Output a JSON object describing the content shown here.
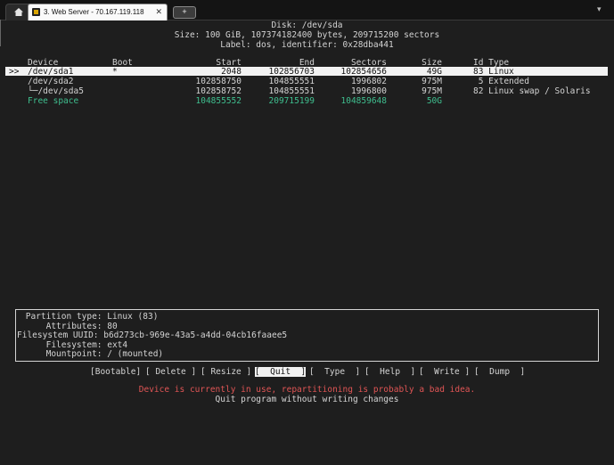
{
  "tabbar": {
    "home_icon": "home-icon",
    "tab_label": "3. Web Server - 70.167.119.118",
    "tab_close": "✕",
    "newtab_label": "+",
    "more_label": "▾"
  },
  "disk": {
    "line1": "Disk: /dev/sda",
    "line2": "Size: 100 GiB, 107374182400 bytes, 209715200 sectors",
    "line3": "Label: dos, identifier: 0x28dba441"
  },
  "table": {
    "headers": {
      "device": "Device",
      "boot": "Boot",
      "start": "Start",
      "end": "End",
      "sectors": "Sectors",
      "size": "Size",
      "id_type": "Id Type"
    },
    "rows": [
      {
        "marker": ">>",
        "device": "/dev/sda1",
        "boot": "*",
        "start": "2048",
        "end": "102856703",
        "sectors": "102854656",
        "size": "49G",
        "id_type": "83 Linux"
      },
      {
        "marker": "",
        "device": "/dev/sda2",
        "boot": "",
        "start": "102858750",
        "end": "104855551",
        "sectors": "1996802",
        "size": "975M",
        "id_type": " 5 Extended"
      },
      {
        "marker": "",
        "device": "└─/dev/sda5",
        "boot": "",
        "start": "102858752",
        "end": "104855551",
        "sectors": "1996800",
        "size": "975M",
        "id_type": "82 Linux swap / Solaris"
      },
      {
        "marker": "",
        "device": "Free space",
        "boot": "",
        "start": "104855552",
        "end": "209715199",
        "sectors": "104859648",
        "size": "50G",
        "id_type": ""
      }
    ]
  },
  "info": {
    "partition_type": " Partition type: Linux (83)",
    "attributes": "     Attributes: 80",
    "fs_uuid": "Filesystem UUID: b6d273cb-969e-43a5-a4dd-04cb16faaee5",
    "filesystem": "     Filesystem: ext4",
    "mountpoint": "     Mountpoint: / (mounted)"
  },
  "menu": {
    "bootable": "[Bootable]",
    "delete": "[ Delete ]",
    "resize": "[ Resize ]",
    "quit": "[  Quit  ]",
    "type": "[  Type  ]",
    "help": "[  Help  ]",
    "write": "[  Write ]",
    "dump": "[  Dump  ]"
  },
  "status": {
    "warning": "Device is currently in use, repartitioning is probably a bad idea.",
    "hint": "Quit program without writing changes"
  },
  "colors": {
    "free_space": "#3fbf8f",
    "warning": "#e05555",
    "selection": "#f2f2f2"
  }
}
